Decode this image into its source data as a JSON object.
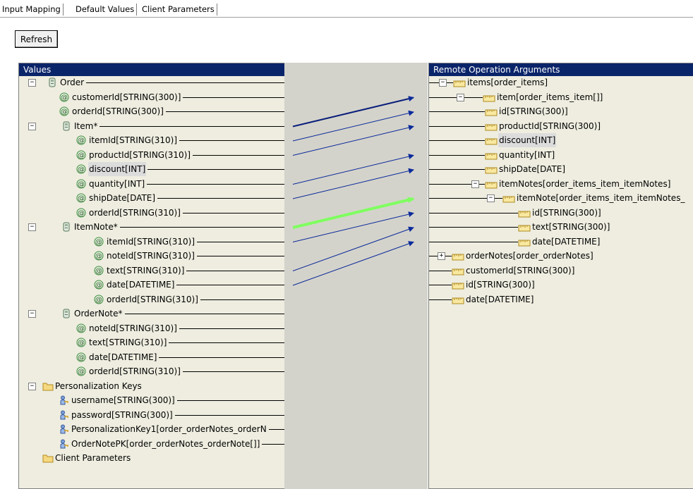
{
  "tabs": [
    "Input Mapping",
    "Default Values",
    "Client Parameters"
  ],
  "refresh_label": "Refresh",
  "left_panel": {
    "title": "Values",
    "rows": [
      {
        "label": "Order",
        "indent": 0,
        "icon": "object",
        "toggle": "-",
        "port": "yellow"
      },
      {
        "label": "customerId[STRING(300)]",
        "indent": 1,
        "icon": "attribute",
        "port": "yellow"
      },
      {
        "label": "orderId[STRING(300)]",
        "indent": 1,
        "icon": "attribute",
        "port": "yellow"
      },
      {
        "label": "Item*",
        "indent": 1,
        "icon": "object",
        "toggle": "-",
        "port": "green"
      },
      {
        "label": "itemId[STRING(310)]",
        "indent": 2,
        "icon": "attribute",
        "port": "green"
      },
      {
        "label": "productId[STRING(310)]",
        "indent": 2,
        "icon": "attribute",
        "port": "green"
      },
      {
        "label": "discount[INT]",
        "indent": 2,
        "icon": "attribute",
        "port": "yellow",
        "selected": true
      },
      {
        "label": "quantity[INT]",
        "indent": 2,
        "icon": "attribute",
        "port": "green"
      },
      {
        "label": "shipDate[DATE]",
        "indent": 2,
        "icon": "attribute",
        "port": "green"
      },
      {
        "label": "orderId[STRING(310)]",
        "indent": 2,
        "icon": "attribute",
        "port": "green"
      },
      {
        "label": "ItemNote*",
        "indent": 1,
        "icon": "object",
        "toggle": "-",
        "port": "green"
      },
      {
        "label": "itemId[STRING(310)]",
        "indent": 3,
        "icon": "attribute",
        "port": "green"
      },
      {
        "label": "noteId[STRING(310)]",
        "indent": 3,
        "icon": "attribute",
        "port": "green"
      },
      {
        "label": "text[STRING(310)]",
        "indent": 3,
        "icon": "attribute",
        "port": "green"
      },
      {
        "label": "date[DATETIME]",
        "indent": 3,
        "icon": "attribute",
        "port": "green"
      },
      {
        "label": "orderId[STRING(310)]",
        "indent": 3,
        "icon": "attribute",
        "port": "yellow"
      },
      {
        "label": "OrderNote*",
        "indent": 1,
        "icon": "object",
        "toggle": "-",
        "port": "yellow"
      },
      {
        "label": "noteId[STRING(310)]",
        "indent": 2,
        "icon": "attribute",
        "port": "yellow"
      },
      {
        "label": "text[STRING(310)]",
        "indent": 2,
        "icon": "attribute",
        "port": "yellow"
      },
      {
        "label": "date[DATETIME]",
        "indent": 2,
        "icon": "attribute",
        "port": "yellow"
      },
      {
        "label": "orderId[STRING(310)]",
        "indent": 2,
        "icon": "attribute",
        "port": "yellow"
      },
      {
        "label": "Personalization Keys",
        "indent": 0,
        "icon": "folder",
        "toggle": "-",
        "port": "none"
      },
      {
        "label": "username[STRING(300)]",
        "indent": 1,
        "icon": "key",
        "port": "yellow"
      },
      {
        "label": "password[STRING(300)]",
        "indent": 1,
        "icon": "key",
        "port": "yellow"
      },
      {
        "label": "PersonalizationKey1[order_orderNotes_orderN",
        "indent": 1,
        "icon": "key",
        "port": "yellow"
      },
      {
        "label": "OrderNotePK[order_orderNotes_orderNote[]]",
        "indent": 1,
        "icon": "key",
        "port": "yellow"
      },
      {
        "label": "Client Parameters",
        "indent": 0,
        "icon": "folder",
        "port": "none"
      }
    ]
  },
  "right_panel": {
    "title": "Remote Operation Arguments",
    "rows": [
      {
        "label": "items[order_items]",
        "indent": 0,
        "toggle": "-",
        "port": "yellow"
      },
      {
        "label": "item[order_items_item[]]",
        "indent": 1,
        "toggle": "-",
        "port": "green"
      },
      {
        "label": "id[STRING(300)]",
        "indent": 2,
        "port": "green"
      },
      {
        "label": "productId[STRING(300)]",
        "indent": 2,
        "port": "green"
      },
      {
        "label": "discount[INT]",
        "indent": 2,
        "port": "yellow",
        "selected": true
      },
      {
        "label": "quantity[INT]",
        "indent": 2,
        "port": "green"
      },
      {
        "label": "shipDate[DATE]",
        "indent": 2,
        "port": "green"
      },
      {
        "label": "itemNotes[order_items_item_itemNotes]",
        "indent": 1,
        "toggle": "-",
        "port": "yellow"
      },
      {
        "label": "itemNote[order_items_item_itemNotes_",
        "indent": 2,
        "toggle": "-",
        "port": "green"
      },
      {
        "label": "id[STRING(300)]",
        "indent": 3,
        "port": "green"
      },
      {
        "label": "text[STRING(300)]",
        "indent": 3,
        "port": "green"
      },
      {
        "label": "date[DATETIME]",
        "indent": 3,
        "port": "green"
      },
      {
        "label": "orderNotes[order_orderNotes]",
        "indent": 0,
        "toggle": "+",
        "port": "yellow"
      },
      {
        "label": "customerId[STRING(300)]",
        "indent": 0,
        "port": "yellow"
      },
      {
        "label": "id[STRING(300)]",
        "indent": 0,
        "port": "yellow"
      },
      {
        "label": "date[DATETIME]",
        "indent": 0,
        "port": "yellow"
      }
    ]
  },
  "mappings": [
    {
      "from": 3,
      "to": 1,
      "color": "#0a1f7a",
      "width": 2
    },
    {
      "from": 4,
      "to": 2,
      "color": "#0a2a9a",
      "width": 1
    },
    {
      "from": 5,
      "to": 3,
      "color": "#0a2a9a",
      "width": 1
    },
    {
      "from": 7,
      "to": 5,
      "color": "#0a2a9a",
      "width": 1
    },
    {
      "from": 8,
      "to": 6,
      "color": "#0a2a9a",
      "width": 1
    },
    {
      "from": 10,
      "to": 8,
      "color": "#7fff60",
      "width": 4
    },
    {
      "from": 11,
      "to": 9,
      "color": "#0a2a9a",
      "width": 1
    },
    {
      "from": 13,
      "to": 10,
      "color": "#0a2a9a",
      "width": 1
    },
    {
      "from": 14,
      "to": 11,
      "color": "#0a2a9a",
      "width": 1
    }
  ],
  "colors": {
    "port_yellow": "#ffd200",
    "port_green": "#1e8a1e",
    "header": "#0a246a"
  }
}
